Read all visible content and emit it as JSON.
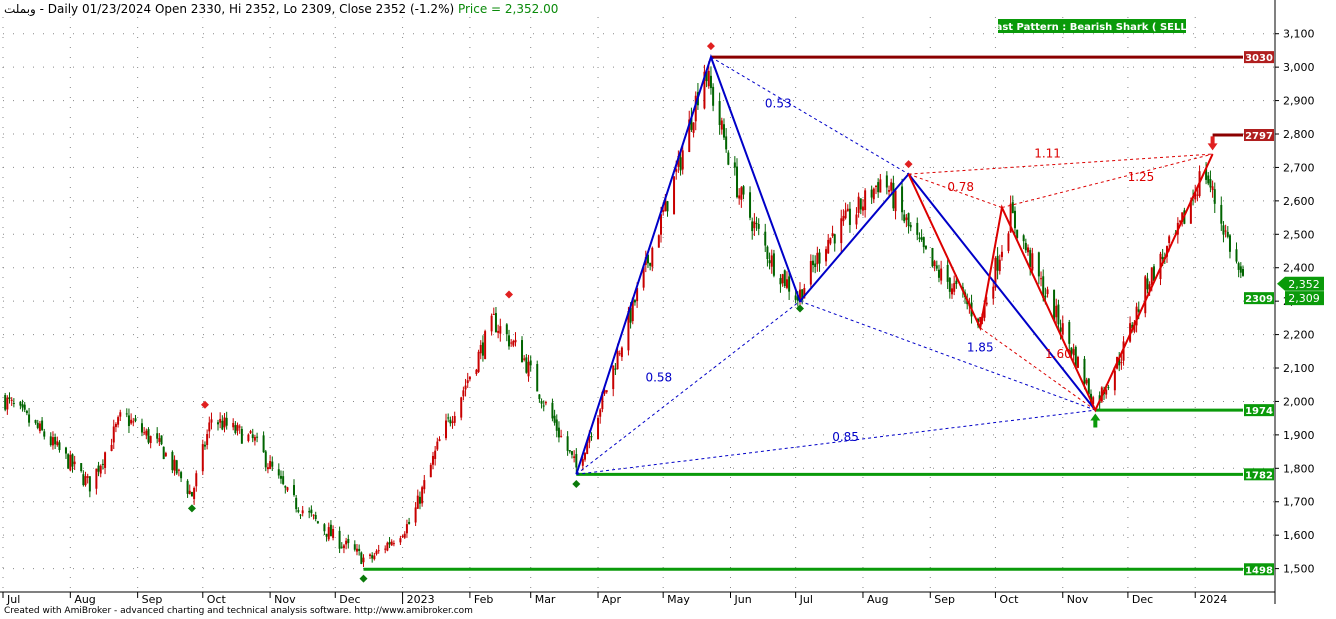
{
  "header": {
    "symbol": "وبملت",
    "info": " - Daily 01/23/2024 Open 2330, Hi 2352, Lo 2309, Close 2352 (-1.2%) ",
    "price_text": "Price = 2,352.00"
  },
  "footer": "Created with AmiBroker - advanced charting and technical analysis software. http://www.amibroker.com",
  "colors": {
    "up": "#c80000",
    "down": "#006400",
    "pattern_blue": "#0000c8",
    "pattern_red": "#dc0000",
    "resistance": "#8b0000",
    "support": "#0a9a0a",
    "badge_red": "#b01e1e",
    "badge_green": "#0a9a0a",
    "grid": "#888888"
  },
  "chart_data": {
    "type": "candlestick",
    "y_axis": {
      "min": 1430,
      "max": 3150,
      "ticks": [
        1500,
        1600,
        1700,
        1800,
        1900,
        2000,
        2100,
        2200,
        2300,
        2400,
        2500,
        2600,
        2700,
        2800,
        2900,
        3000,
        3100
      ],
      "tick_labels": [
        "1,500",
        "1,600",
        "1,700",
        "1,800",
        "1,900",
        "2,000",
        "2,100",
        "2,200",
        "2,300",
        "2,400",
        "2,500",
        "2,600",
        "2,700",
        "2,800",
        "2,900",
        "3,000",
        "3,100"
      ]
    },
    "x_axis": {
      "labels": [
        "Jul",
        "Aug",
        "Sep",
        "Oct",
        "Nov",
        "Dec",
        "2023",
        "Feb",
        "Mar",
        "Apr",
        "May",
        "Jun",
        "Jul",
        "Aug",
        "Sep",
        "Oct",
        "Nov",
        "Dec",
        "2024"
      ],
      "major_index": 6,
      "start": "2022-07-01",
      "end": "2024-01-23"
    },
    "anchors": [
      [
        "2022-07-01",
        2010
      ],
      [
        "2022-07-20",
        1900
      ],
      [
        "2022-08-10",
        1750
      ],
      [
        "2022-08-25",
        1960
      ],
      [
        "2022-09-12",
        1860
      ],
      [
        "2022-09-26",
        1720
      ],
      [
        "2022-10-05",
        1950
      ],
      [
        "2022-10-25",
        1880
      ],
      [
        "2022-11-10",
        1710
      ],
      [
        "2022-12-01",
        1590
      ],
      [
        "2022-12-16",
        1520
      ],
      [
        "2023-01-05",
        1640
      ],
      [
        "2023-01-18",
        1880
      ],
      [
        "2023-02-01",
        2080
      ],
      [
        "2023-02-12",
        2240
      ],
      [
        "2023-02-25",
        2140
      ],
      [
        "2023-03-10",
        1960
      ],
      [
        "2023-03-22",
        1800
      ],
      [
        "2023-04-05",
        2040
      ],
      [
        "2023-04-22",
        2380
      ],
      [
        "2023-05-08",
        2700
      ],
      [
        "2023-05-20",
        3000
      ],
      [
        "2023-06-05",
        2620
      ],
      [
        "2023-06-20",
        2420
      ],
      [
        "2023-07-02",
        2310
      ],
      [
        "2023-07-15",
        2480
      ],
      [
        "2023-07-28",
        2560
      ],
      [
        "2023-08-10",
        2670
      ],
      [
        "2023-08-22",
        2520
      ],
      [
        "2023-09-02",
        2400
      ],
      [
        "2023-09-12",
        2340
      ],
      [
        "2023-09-24",
        2240
      ],
      [
        "2023-10-08",
        2560
      ],
      [
        "2023-10-22",
        2350
      ],
      [
        "2023-11-05",
        2160
      ],
      [
        "2023-11-16",
        1990
      ],
      [
        "2023-11-28",
        2140
      ],
      [
        "2023-12-10",
        2360
      ],
      [
        "2023-12-24",
        2500
      ],
      [
        "2024-01-05",
        2700
      ],
      [
        "2024-01-12",
        2560
      ],
      [
        "2024-01-23",
        2352
      ]
    ],
    "pattern_blue": {
      "points": [
        [
          "2023-03-22",
          1782
        ],
        [
          "2023-05-23",
          3030
        ],
        [
          "2023-07-03",
          2300
        ],
        [
          "2023-08-22",
          2680
        ],
        [
          "2023-11-16",
          1974
        ]
      ],
      "dashed": [
        [
          0,
          2
        ],
        [
          0,
          4
        ],
        [
          1,
          3
        ],
        [
          2,
          4
        ]
      ],
      "ratios": [
        {
          "text": "0.58",
          "at": [
            "2023-04-29",
            2060
          ]
        },
        {
          "text": "0.53",
          "at": [
            "2023-06-23",
            2880
          ]
        },
        {
          "text": "1.85",
          "at": [
            "2023-09-24",
            2150
          ]
        },
        {
          "text": "0.85",
          "at": [
            "2023-07-24",
            1882
          ]
        }
      ]
    },
    "pattern_red": {
      "points": [
        [
          "2023-08-22",
          2680
        ],
        [
          "2023-09-24",
          2220
        ],
        [
          "2023-10-04",
          2580
        ],
        [
          "2023-11-16",
          1974
        ],
        [
          "2024-01-09",
          2740
        ]
      ],
      "dashed": [
        [
          0,
          2
        ],
        [
          0,
          4
        ],
        [
          2,
          4
        ],
        [
          1,
          3
        ]
      ],
      "ratios": [
        {
          "text": "0.78",
          "at": [
            "2023-09-15",
            2630
          ]
        },
        {
          "text": "1.11",
          "at": [
            "2023-10-25",
            2730
          ]
        },
        {
          "text": "1.25",
          "at": [
            "2023-12-07",
            2660
          ]
        },
        {
          "text": "1.60",
          "at": [
            "2023-10-30",
            2130
          ]
        }
      ]
    },
    "levels": [
      {
        "value": 3030,
        "label": "3030",
        "kind": "resistance",
        "from": "2023-05-23"
      },
      {
        "value": 2797,
        "label": "2797",
        "kind": "resistance",
        "from": "2024-01-09"
      },
      {
        "value": 2309,
        "label": "2309",
        "kind": "support",
        "from": null
      },
      {
        "value": 1974,
        "label": "1974",
        "kind": "support",
        "from": "2023-11-16"
      },
      {
        "value": 1782,
        "label": "1782",
        "kind": "support",
        "from": "2023-03-22"
      },
      {
        "value": 1498,
        "label": "1498",
        "kind": "support",
        "from": "2022-12-14"
      }
    ],
    "price_badges": [
      {
        "value": 2352,
        "label": "2,352",
        "color": "#0a9a0a",
        "arrow": true
      },
      {
        "value": 2309,
        "label": "2,309",
        "color": "#0a9a0a",
        "arrow": false
      }
    ],
    "markers": [
      {
        "date": "2022-10-02",
        "value": 1990,
        "color": "#e02020",
        "shape": "diamond"
      },
      {
        "date": "2022-09-26",
        "value": 1680,
        "color": "#0a7a0a",
        "shape": "diamond"
      },
      {
        "date": "2022-12-14",
        "value": 1470,
        "color": "#0a7a0a",
        "shape": "diamond"
      },
      {
        "date": "2023-02-19",
        "value": 2320,
        "color": "#e02020",
        "shape": "diamond"
      },
      {
        "date": "2023-03-22",
        "value": 1753,
        "color": "#0a7a0a",
        "shape": "diamond"
      },
      {
        "date": "2023-05-23",
        "value": 3063,
        "color": "#e02020",
        "shape": "diamond"
      },
      {
        "date": "2023-07-03",
        "value": 2278,
        "color": "#0a7a0a",
        "shape": "diamond"
      },
      {
        "date": "2023-08-22",
        "value": 2710,
        "color": "#e02020",
        "shape": "diamond"
      },
      {
        "date": "2023-11-16",
        "value": 1940,
        "color": "#0a9a0a",
        "shape": "arrow-up"
      },
      {
        "date": "2024-01-09",
        "value": 2775,
        "color": "#e02020",
        "shape": "arrow-down"
      }
    ],
    "annotation": "Last Pattern : Bearish Shark ( SELL )"
  }
}
